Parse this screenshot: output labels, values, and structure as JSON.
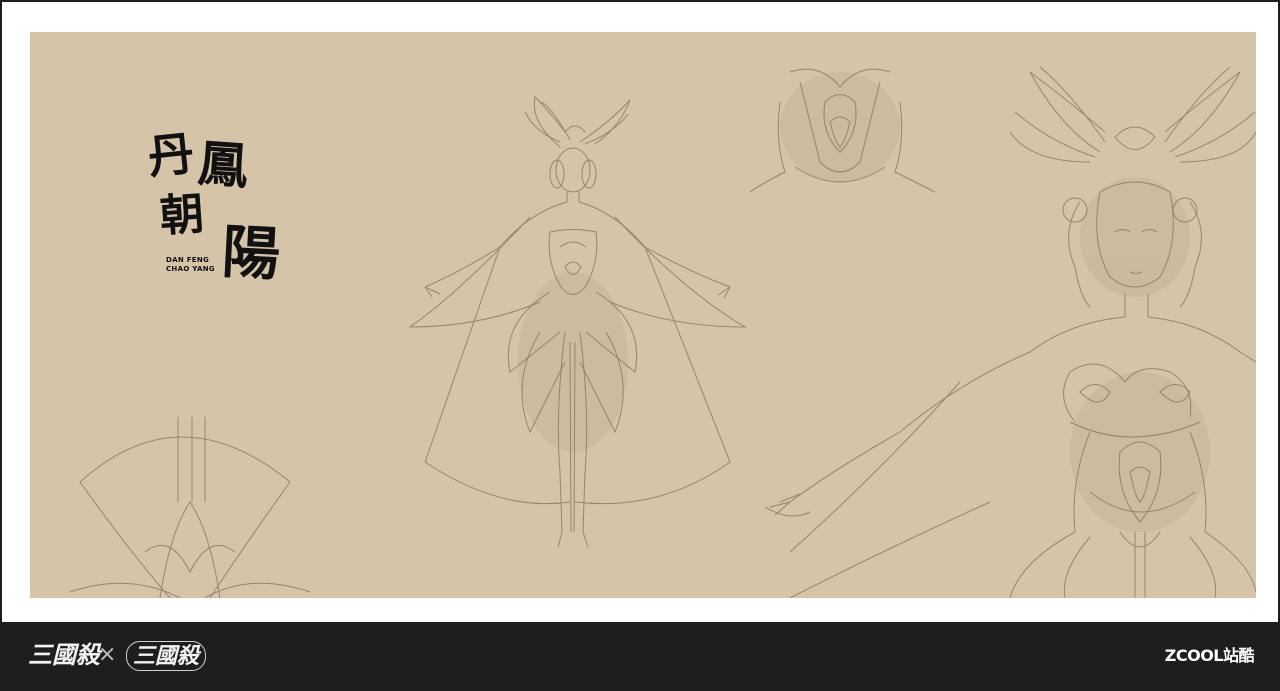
{
  "artwork": {
    "title_chars": [
      "丹",
      "鳳",
      "朝",
      "陽"
    ],
    "romanization_line1": "DAN FENG",
    "romanization_line2": "CHAO YANG",
    "background_color": "#d6c4a8",
    "line_color": "#8a7a66"
  },
  "footer": {
    "logo_left": "三國殺",
    "separator": "×",
    "logo_right": "三國殺",
    "site_logo": "ZCOOL站酷"
  }
}
